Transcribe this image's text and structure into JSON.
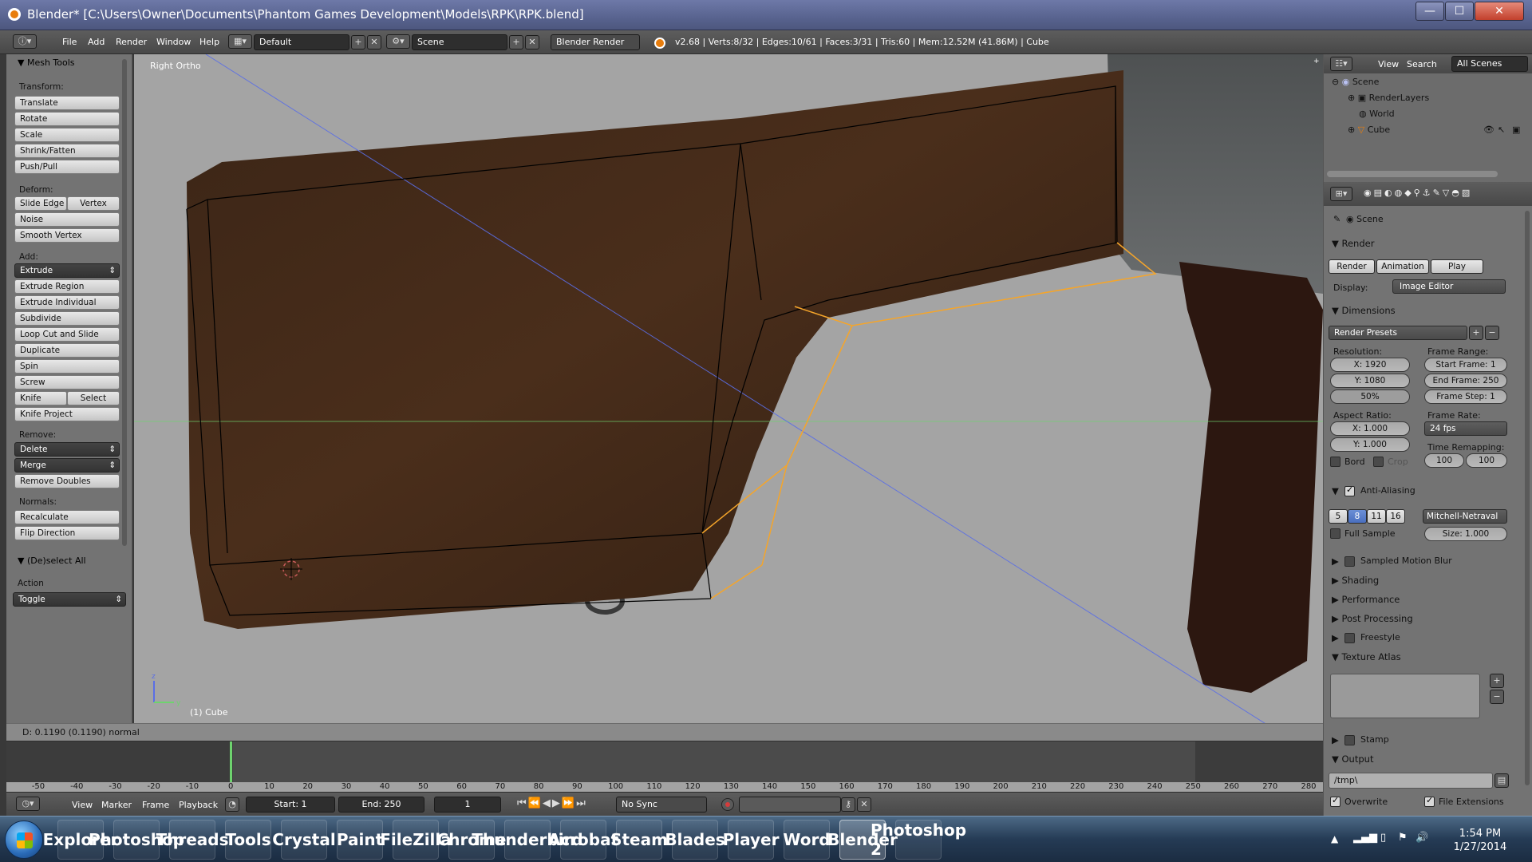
{
  "window": {
    "title": "Blender* [C:\\Users\\Owner\\Documents\\Phantom Games Development\\Models\\RPK\\RPK.blend]",
    "min": "—",
    "max": "☐",
    "close": "✕"
  },
  "infobar": {
    "menus": [
      "File",
      "Add",
      "Render",
      "Window",
      "Help"
    ],
    "layout": "Default",
    "scene": "Scene",
    "engine": "Blender Render",
    "stats": "v2.68 | Verts:8/32 | Edges:10/61 | Faces:3/31 | Tris:60 | Mem:12.52M (41.86M) | Cube"
  },
  "toolshelf": {
    "panel_title": "Mesh Tools",
    "transform_label": "Transform:",
    "transform": [
      "Translate",
      "Rotate",
      "Scale",
      "Shrink/Fatten",
      "Push/Pull"
    ],
    "deform_label": "Deform:",
    "slide_edge": "Slide Edge",
    "vertex": "Vertex",
    "deform": [
      "Noise",
      "Smooth Vertex"
    ],
    "add_label": "Add:",
    "extrude": "Extrude",
    "add": [
      "Extrude Region",
      "Extrude Individual",
      "Subdivide",
      "Loop Cut and Slide",
      "Duplicate",
      "Spin",
      "Screw"
    ],
    "knife": "Knife",
    "select": "Select",
    "knife_project": "Knife Project",
    "remove_label": "Remove:",
    "delete": "Delete",
    "merge": "Merge",
    "remove_doubles": "Remove Doubles",
    "normals_label": "Normals:",
    "recalculate": "Recalculate",
    "flip_direction": "Flip Direction",
    "deselect_title": "(De)select All",
    "action_label": "Action",
    "action_value": "Toggle"
  },
  "viewport": {
    "view_name": "Right Ortho",
    "object_name": "(1) Cube"
  },
  "status": {
    "text": "D: 0.1190 (0.1190) normal"
  },
  "timeline": {
    "ticks": [
      -50,
      -40,
      -30,
      -20,
      -10,
      0,
      10,
      20,
      30,
      40,
      50,
      60,
      70,
      80,
      90,
      100,
      110,
      120,
      130,
      140,
      150,
      160,
      170,
      180,
      190,
      200,
      210,
      220,
      230,
      240,
      250,
      260,
      270,
      280
    ],
    "current_frame_value": 0,
    "menus": [
      "View",
      "Marker",
      "Frame",
      "Playback"
    ],
    "start": "Start: 1",
    "end": "End: 250",
    "current": "1",
    "sync": "No Sync"
  },
  "outliner": {
    "menus": [
      "View",
      "Search"
    ],
    "filter": "All Scenes",
    "items": [
      "Scene",
      "RenderLayers",
      "World",
      "Cube"
    ]
  },
  "properties": {
    "context": "Scene",
    "render_title": "Render",
    "render_btn": "Render",
    "animation_btn": "Animation",
    "play_btn": "Play",
    "display_label": "Display:",
    "display_value": "Image Editor",
    "dimensions_title": "Dimensions",
    "render_presets": "Render Presets",
    "resolution_label": "Resolution:",
    "res_x": "X: 1920",
    "res_y": "Y: 1080",
    "res_pct": "50%",
    "frame_range_label": "Frame Range:",
    "start_frame": "Start Frame: 1",
    "end_frame": "End Frame: 250",
    "frame_step": "Frame Step: 1",
    "aspect_label": "Aspect Ratio:",
    "asp_x": "X: 1.000",
    "asp_y": "Y: 1.000",
    "frame_rate_label": "Frame Rate:",
    "fps": "24 fps",
    "time_remap_label": "Time Remapping:",
    "remap_old": "100",
    "remap_new": "100",
    "bord": "Bord",
    "crop": "Crop",
    "aa_title": "Anti-Aliasing",
    "aa_samples": [
      "5",
      "8",
      "11",
      "16"
    ],
    "aa_filter": "Mitchell-Netraval",
    "full_sample": "Full Sample",
    "aa_size": "Size: 1.000",
    "sampled_motion_blur": "Sampled Motion Blur",
    "shading": "Shading",
    "performance": "Performance",
    "post_processing": "Post Processing",
    "freestyle": "Freestyle",
    "texture_atlas": "Texture Atlas",
    "stamp": "Stamp",
    "output_title": "Output",
    "output_path": "/tmp\\",
    "overwrite": "Overwrite",
    "file_extensions": "File Extensions"
  },
  "taskbar": {
    "apps": [
      "Explorer",
      "Photoshop",
      "Threads",
      "Tools",
      "Crystal",
      "Paint",
      "FileZilla",
      "Chrome",
      "Thunderbird",
      "Acrobat",
      "Steam",
      "Blades",
      "Player",
      "Word",
      "Blender",
      "Photoshop 2"
    ],
    "time": "1:54 PM",
    "date": "1/27/2014"
  },
  "colors": {
    "accent": "#e87d0d",
    "selection_orange": "#f5a52a",
    "x_axis": "#c75a5a",
    "y_axis": "#6ed36e",
    "z_axis": "#5a6ee6"
  }
}
